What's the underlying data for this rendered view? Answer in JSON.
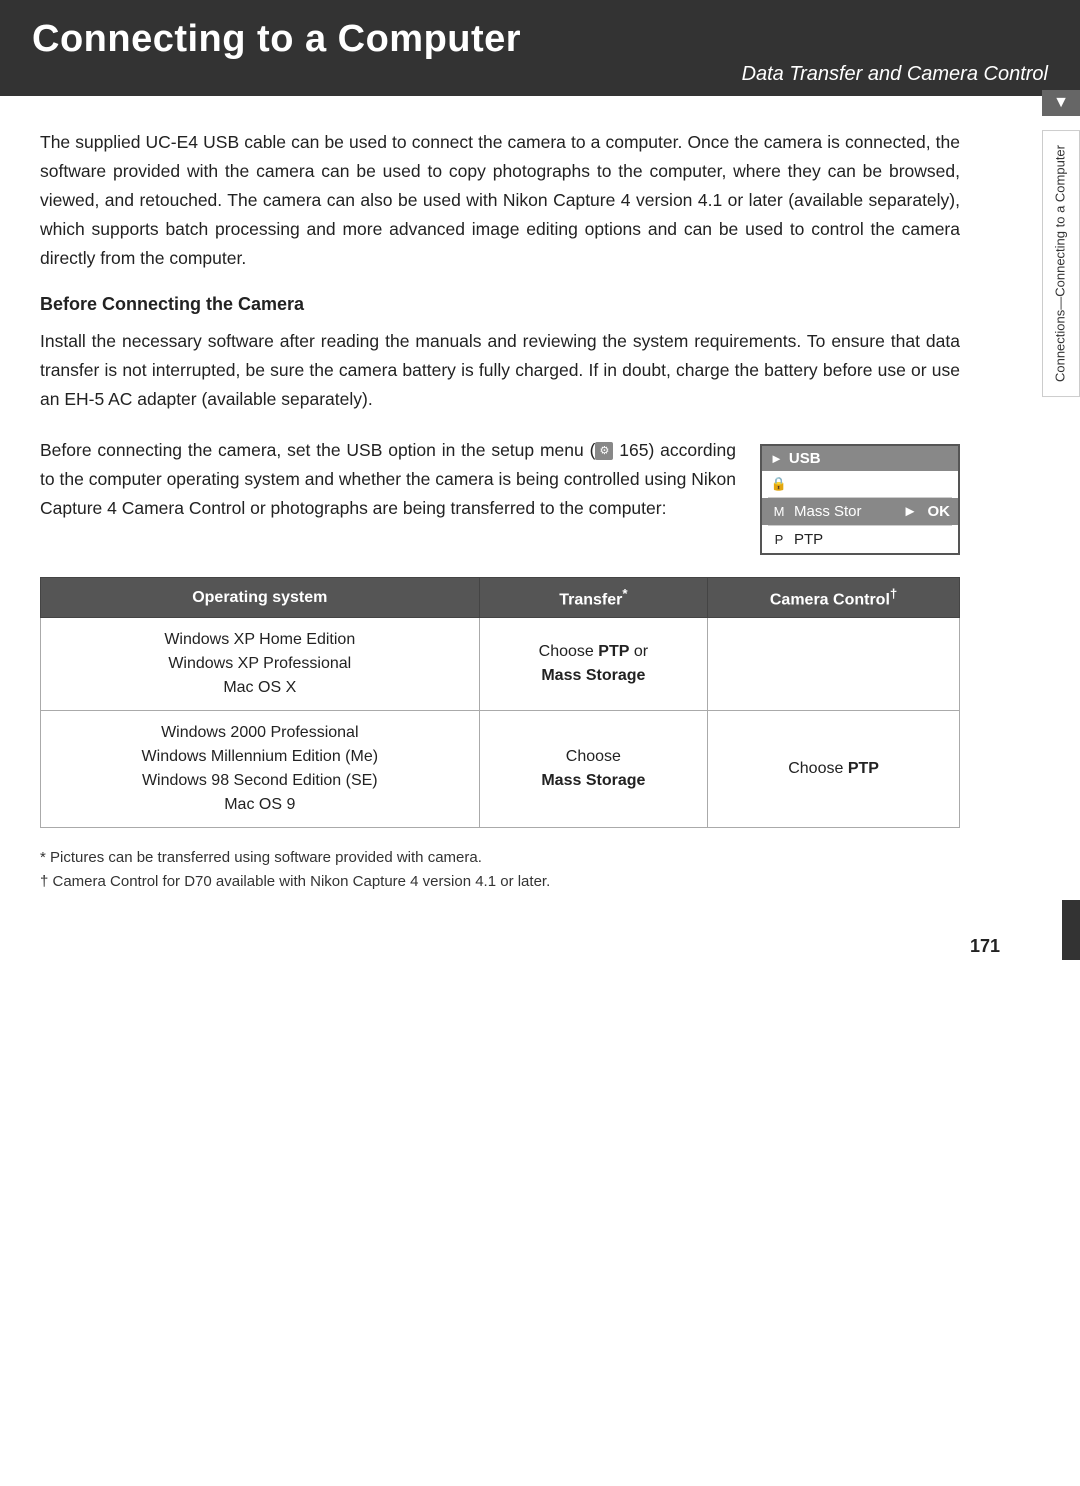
{
  "header": {
    "title": "Connecting to a Computer",
    "subtitle": "Data Transfer and Camera Control"
  },
  "side_tab": {
    "text": "Connections—Connecting to a Computer"
  },
  "intro": {
    "paragraph": "The supplied UC-E4 USB cable can be used to connect the camera to a computer.  Once the camera is connected, the software provided with the camera can be used to copy photographs to the computer, where they can be browsed, viewed, and retouched.  The camera can also be used with Nikon Capture 4 version 4.1 or later (available separately), which supports batch processing and more advanced image editing options and can be used to control the camera directly from the computer."
  },
  "section": {
    "heading": "Before Connecting the Camera",
    "para1": "Install the necessary software after reading the manuals and reviewing the system requirements.  To ensure that data transfer is not interrupted, be sure the camera battery is fully charged.  If in doubt, charge the battery before use or use an EH-5 AC adapter (available separately).",
    "para2_part1": "Before connecting the camera, set the USB option in the setup menu (",
    "para2_setup_ref": "165",
    "para2_part2": ") according to the computer operating system and whether the camera is being controlled using Nikon Capture 4 Camera Control or photographs are being transferred to the computer:"
  },
  "usb_menu": {
    "header": "USB",
    "rows": [
      {
        "icon": "■",
        "label": "",
        "sublabel": "",
        "selected": false,
        "empty": true
      },
      {
        "icon": "M",
        "label": "Mass Stor",
        "arrow": "▶",
        "ok": "OK",
        "selected": true
      },
      {
        "icon": "P",
        "label": "PTP",
        "selected": false
      }
    ]
  },
  "table": {
    "headers": [
      "Operating system",
      "Transfer*",
      "Camera Control†"
    ],
    "rows": [
      {
        "os": "Windows XP Home Edition\nWindows XP Professional\nMac OS X",
        "transfer_prefix": "Choose ",
        "transfer_bold1": "PTP",
        "transfer_or": " or",
        "transfer_newline": true,
        "transfer_bold2": "Mass Storage",
        "camera_control": ""
      },
      {
        "os": "Windows 2000 Professional\nWindows Millennium Edition (Me)\nWindows 98 Second Edition (SE)\nMac OS 9",
        "transfer_prefix": "Choose",
        "transfer_newline": true,
        "transfer_bold2": "Mass Storage",
        "camera_control_prefix": "Choose ",
        "camera_control_bold": "PTP"
      }
    ]
  },
  "footnotes": {
    "star": "* Pictures can be transferred using software provided with camera.",
    "dagger": "† Camera Control for D70 available with Nikon Capture 4 version 4.1 or later."
  },
  "page_number": "171"
}
